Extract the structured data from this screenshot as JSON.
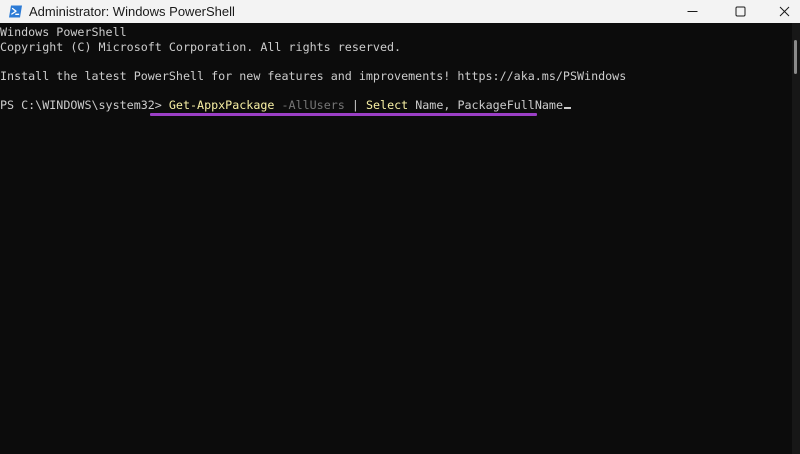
{
  "window": {
    "title": "Administrator: Windows PowerShell",
    "icon": "powershell-icon",
    "controls": {
      "minimize": "minimize-icon",
      "maximize": "maximize-icon",
      "close": "close-icon"
    }
  },
  "console": {
    "lines": [
      "Windows PowerShell",
      "Copyright (C) Microsoft Corporation. All rights reserved.",
      "Install the latest PowerShell for new features and improvements! https://aka.ms/PSWindows"
    ],
    "prompt": "PS C:\\WINDOWS\\system32> ",
    "command": {
      "cmdlet": "Get-AppxPackage",
      "param": " -AllUsers",
      "pipe": " | ",
      "select": "Select",
      "args": " Name, PackageFullName"
    }
  },
  "colors": {
    "background": "#0c0c0c",
    "foreground": "#cccccc",
    "command": "#f9f1a5",
    "parameter": "#767676",
    "highlight": "#9b3fc6",
    "titlebar": "#f3f3f3"
  }
}
